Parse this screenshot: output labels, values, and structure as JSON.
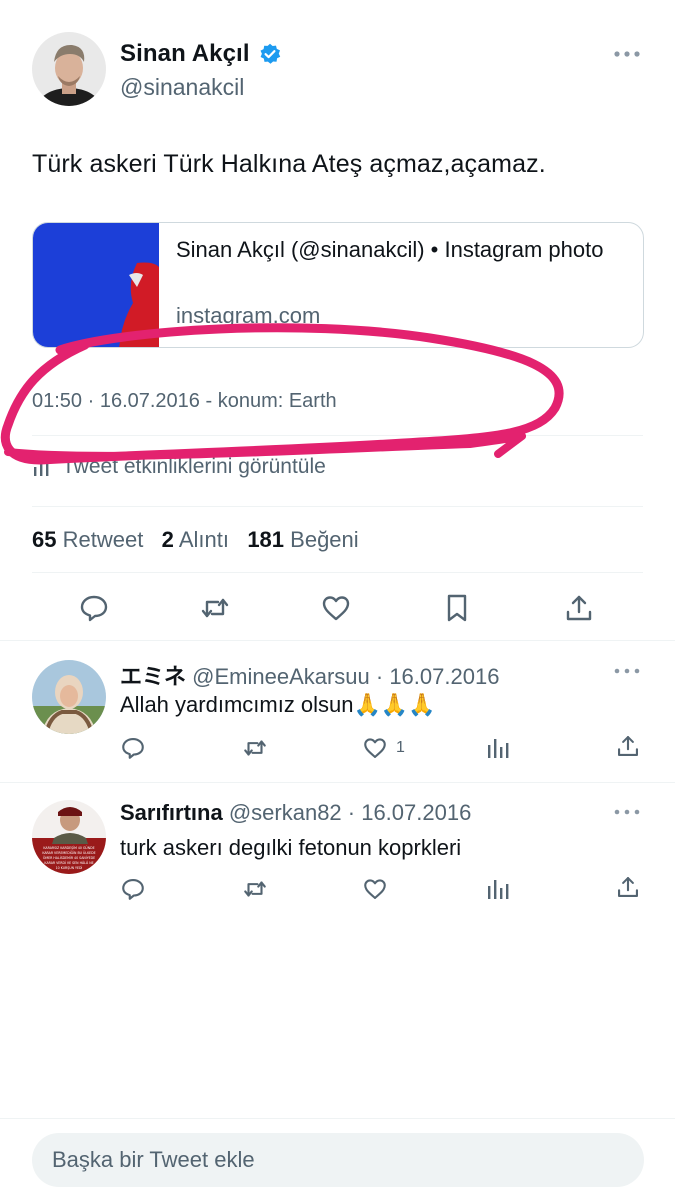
{
  "tweet": {
    "author_name": "Sinan Akçıl",
    "author_handle": "@sinanakcil",
    "text": "Türk askeri Türk Halkına Ateş açmaz,açamaz.",
    "link_card": {
      "title": "Sinan Akçıl (@sinanakcil) • Instagram photo",
      "domain": "instagram.com"
    },
    "meta": "01:50 · 16.07.2016 - konum: Earth",
    "activity_label": "Tweet etkinliklerini görüntüle",
    "stats": {
      "retweets": "65",
      "retweets_label": "Retweet",
      "quotes": "2",
      "quotes_label": "Alıntı",
      "likes": "181",
      "likes_label": "Beğeni"
    }
  },
  "replies": [
    {
      "name": "エミネ",
      "handle_date": "@EmineeAkarsuu · 16.07.2016",
      "text": "Allah yardımcımız olsun🙏🙏🙏",
      "like_count": "1"
    },
    {
      "name": "Sarıfırtına",
      "handle_date": "@serkan82 · 16.07.2016",
      "text": "turk askerı degılki fetonun koprkleri",
      "avatar_text": "KARARSIZ KARDEŞİM 40 GÜNDE KARAR VEREMEDİĞİN BU ÜLKEDE ÖMER HALİSDEMİR 40 SANİYEDE KARAR VERDİ VE SEN HÂLÂ NE 10 KURŞUN YEDİ"
    }
  ],
  "composer": {
    "placeholder": "Başka bir Tweet ekle"
  },
  "colors": {
    "accent": "#1d9bf0",
    "annotation": "#e3226f",
    "text_secondary": "#536471"
  },
  "icons": [
    "verified-badge-icon",
    "more-icon",
    "reply-icon",
    "retweet-icon",
    "like-icon",
    "bookmark-icon",
    "share-icon",
    "analytics-icon",
    "bar-chart-icon"
  ]
}
